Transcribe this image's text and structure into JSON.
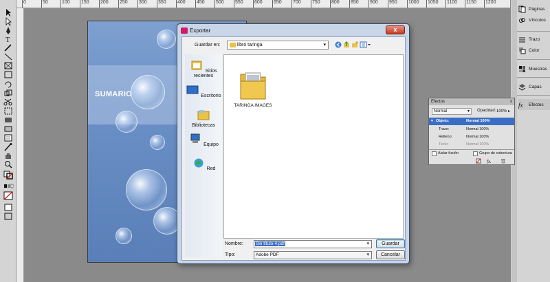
{
  "ruler": {
    "labels": [
      "0",
      "50",
      "100",
      "150",
      "200",
      "250",
      "300",
      "350",
      "400",
      "450",
      "500",
      "550",
      "600",
      "650",
      "700",
      "750",
      "800",
      "850",
      "900",
      "950",
      "1000",
      "1050",
      "1100",
      "1150",
      "1200"
    ]
  },
  "page": {
    "title": "SUMARIO"
  },
  "dock": {
    "items": [
      {
        "label": "Páginas",
        "icon": "pages-icon"
      },
      {
        "label": "Vínculos",
        "icon": "links-icon"
      },
      {
        "label": "Trazo",
        "icon": "stroke-icon"
      },
      {
        "label": "Color",
        "icon": "color-icon"
      },
      {
        "label": "Muestras",
        "icon": "swatches-icon"
      },
      {
        "label": "Capas",
        "icon": "layers-icon"
      },
      {
        "label": "Efectos",
        "icon": "effects-icon"
      }
    ]
  },
  "efectos": {
    "title": "Efectos",
    "close": "x",
    "blend_mode": "Normal",
    "opacity_label": "Opacidad:",
    "opacity_value": "100%",
    "rows": [
      {
        "name": "Objeto:",
        "value": "Normal 100%"
      },
      {
        "name": "Trazo:",
        "value": "Normal 100%"
      },
      {
        "name": "Relleno:",
        "value": "Normal 100%"
      },
      {
        "name": "Texto:",
        "value": "Normal 100%"
      }
    ],
    "isolate_label": "Aislar fusión",
    "knockout_label": "Grupo de cobertura"
  },
  "dialog": {
    "title": "Exportar",
    "close": "x",
    "save_in_label": "Guardar en:",
    "save_in_value": "libro taringa",
    "places": [
      {
        "label": "Sitios recientes",
        "icon": "recent-places-icon"
      },
      {
        "label": "Escritorio",
        "icon": "desktop-icon"
      },
      {
        "label": "Bibliotecas",
        "icon": "libraries-icon"
      },
      {
        "label": "Equipo",
        "icon": "computer-icon"
      },
      {
        "label": "Red",
        "icon": "network-icon"
      }
    ],
    "files": [
      {
        "name": "TARINGA IMAGES",
        "icon": "folder-icon"
      }
    ],
    "name_label": "Nombre:",
    "name_value": "Sin título-4.pdf",
    "type_label": "Tipo:",
    "type_value": "Adobe PDF",
    "save_button": "Guardar",
    "cancel_button": "Cancelar"
  },
  "colors": {
    "accent": "#3a6ec4",
    "close_button": "#c23a22",
    "app_icon": "#d01a6a"
  }
}
